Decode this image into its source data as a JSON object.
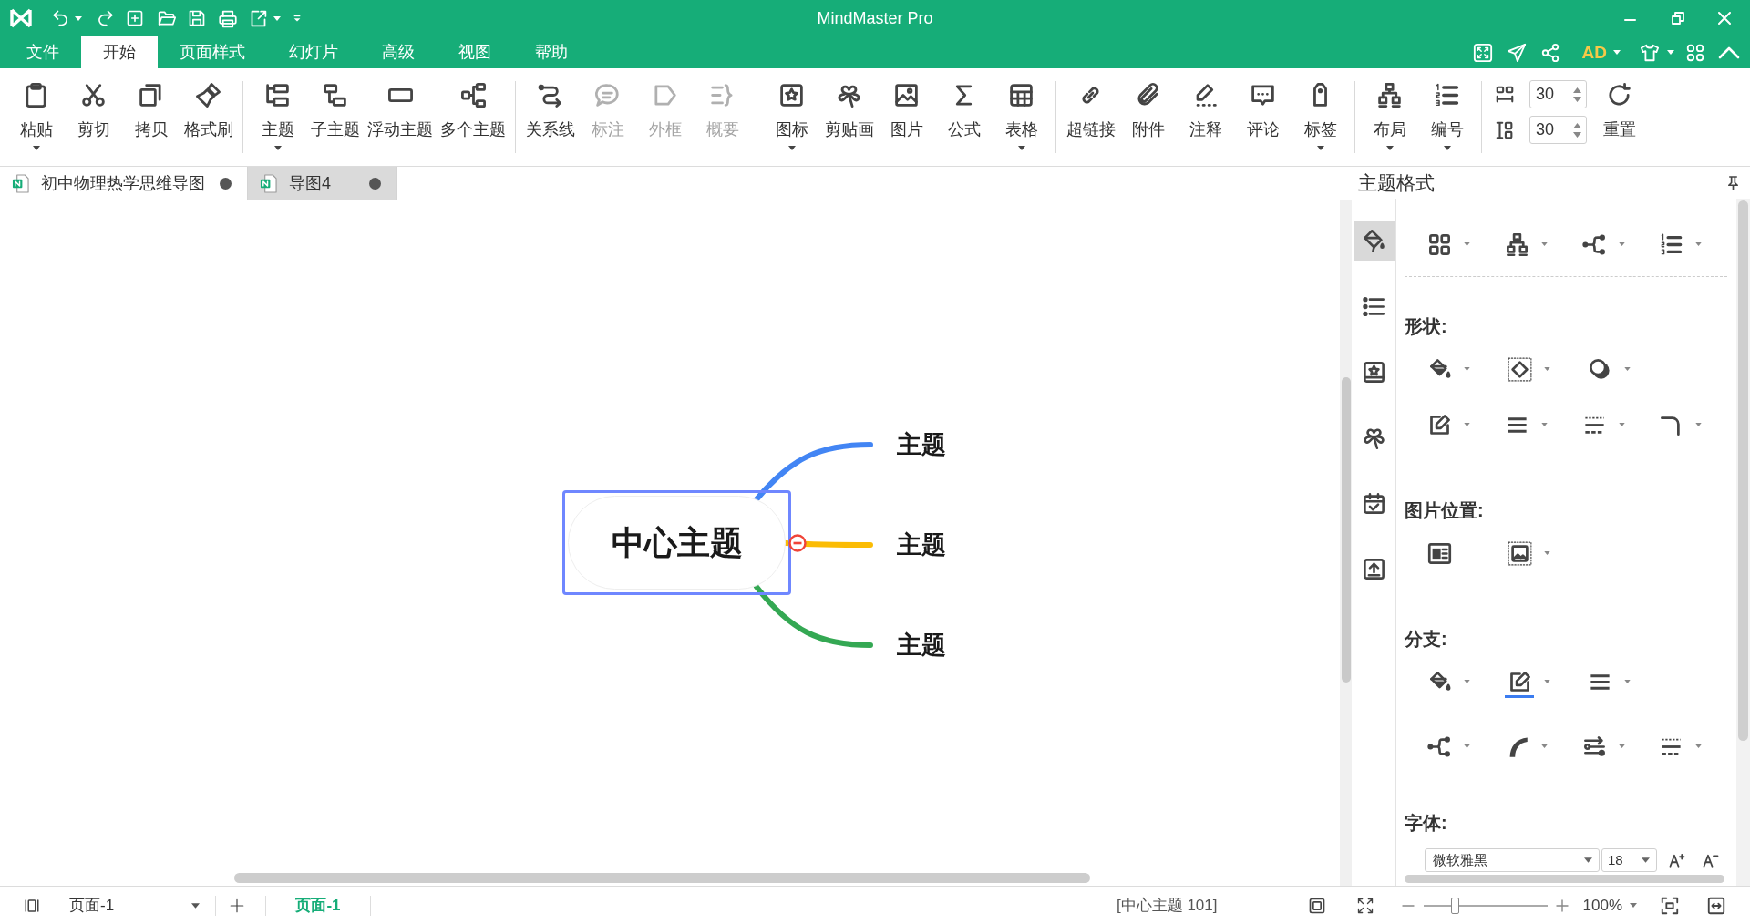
{
  "window": {
    "title": "MindMaster Pro"
  },
  "menu_tabs": [
    {
      "label": "文件",
      "selected": false
    },
    {
      "label": "开始",
      "selected": true
    },
    {
      "label": "页面样式",
      "selected": false
    },
    {
      "label": "幻灯片",
      "selected": false
    },
    {
      "label": "高级",
      "selected": false
    },
    {
      "label": "视图",
      "selected": false
    },
    {
      "label": "帮助",
      "selected": false
    }
  ],
  "account": {
    "label": "AD"
  },
  "ribbon": {
    "groups": [
      {
        "items": [
          {
            "label": "粘贴",
            "dropdown": true,
            "disabled": false
          },
          {
            "label": "剪切",
            "dropdown": false,
            "disabled": false
          },
          {
            "label": "拷贝",
            "dropdown": false,
            "disabled": false
          },
          {
            "label": "格式刷",
            "dropdown": false,
            "disabled": false
          }
        ]
      },
      {
        "items": [
          {
            "label": "主题",
            "dropdown": true,
            "disabled": false
          },
          {
            "label": "子主题",
            "dropdown": false,
            "disabled": false
          },
          {
            "label": "浮动主题",
            "dropdown": false,
            "disabled": false
          },
          {
            "label": "多个主题",
            "dropdown": false,
            "disabled": false
          }
        ]
      },
      {
        "items": [
          {
            "label": "关系线",
            "dropdown": false,
            "disabled": false
          },
          {
            "label": "标注",
            "dropdown": false,
            "disabled": true
          },
          {
            "label": "外框",
            "dropdown": false,
            "disabled": true
          },
          {
            "label": "概要",
            "dropdown": false,
            "disabled": true
          }
        ]
      },
      {
        "items": [
          {
            "label": "图标",
            "dropdown": true,
            "disabled": false
          },
          {
            "label": "剪贴画",
            "dropdown": false,
            "disabled": false
          },
          {
            "label": "图片",
            "dropdown": false,
            "disabled": false
          },
          {
            "label": "公式",
            "dropdown": false,
            "disabled": false
          },
          {
            "label": "表格",
            "dropdown": true,
            "disabled": false
          }
        ]
      },
      {
        "items": [
          {
            "label": "超链接",
            "dropdown": false,
            "disabled": false
          },
          {
            "label": "附件",
            "dropdown": false,
            "disabled": false
          },
          {
            "label": "注释",
            "dropdown": false,
            "disabled": false
          },
          {
            "label": "评论",
            "dropdown": false,
            "disabled": false
          },
          {
            "label": "标签",
            "dropdown": true,
            "disabled": false
          }
        ]
      },
      {
        "items": [
          {
            "label": "布局",
            "dropdown": true,
            "disabled": false
          },
          {
            "label": "编号",
            "dropdown": true,
            "disabled": false
          }
        ]
      }
    ],
    "spacing_fields": [
      {
        "value": "30"
      },
      {
        "value": "30"
      }
    ],
    "reset_button": {
      "label": "重置"
    }
  },
  "doc_tabs": [
    {
      "title": "初中物理热学思维导图",
      "selected": false,
      "modified": true
    },
    {
      "title": "导图4",
      "selected": true,
      "modified": true
    }
  ],
  "mind_map": {
    "central": {
      "text": "中心主题",
      "selected": true
    },
    "topics": [
      {
        "text": "主题",
        "color": "#4285f4"
      },
      {
        "text": "主题",
        "color": "#fbbc04"
      },
      {
        "text": "主题",
        "color": "#34a853"
      }
    ]
  },
  "format_panel": {
    "title": "主题格式",
    "side_tabs": [
      {
        "selected": true
      },
      {
        "selected": false
      },
      {
        "selected": false
      },
      {
        "selected": false
      },
      {
        "selected": false
      },
      {
        "selected": false
      }
    ],
    "top_tools": [
      {
        "dropdown": true
      },
      {
        "dropdown": true
      },
      {
        "dropdown": true
      },
      {
        "dropdown": true
      }
    ],
    "sections": [
      {
        "kind": "tools",
        "title": "形状:",
        "rows": [
          [
            {
              "dropdown": true
            },
            {
              "dropdown": true
            },
            {
              "dropdown": true
            }
          ],
          [
            {
              "dropdown": true
            },
            {
              "dropdown": true
            },
            {
              "dropdown": true
            },
            {
              "dropdown": true
            }
          ]
        ]
      },
      {
        "kind": "tools",
        "title": "图片位置:",
        "rows": [
          [
            {
              "dropdown": false
            },
            {
              "dropdown": true
            }
          ]
        ]
      },
      {
        "kind": "tools",
        "title": "分支:",
        "rows": [
          [
            {
              "dropdown": true
            },
            {
              "dropdown": true,
              "color": "#3b7cf0"
            },
            {
              "dropdown": true
            }
          ],
          [
            {
              "dropdown": true
            },
            {
              "dropdown": true
            },
            {
              "dropdown": true
            },
            {
              "dropdown": true
            }
          ]
        ]
      },
      {
        "kind": "font",
        "title": "字体:",
        "font_family": "微软雅黑",
        "font_size": "18"
      }
    ]
  },
  "status_bar": {
    "page_select": {
      "value": "页面-1"
    },
    "page_tabs": [
      {
        "label": "页面-1",
        "selected": true
      }
    ],
    "info": "[中心主题 101]",
    "zoom": {
      "level": 0.26,
      "reading": "100%"
    }
  }
}
